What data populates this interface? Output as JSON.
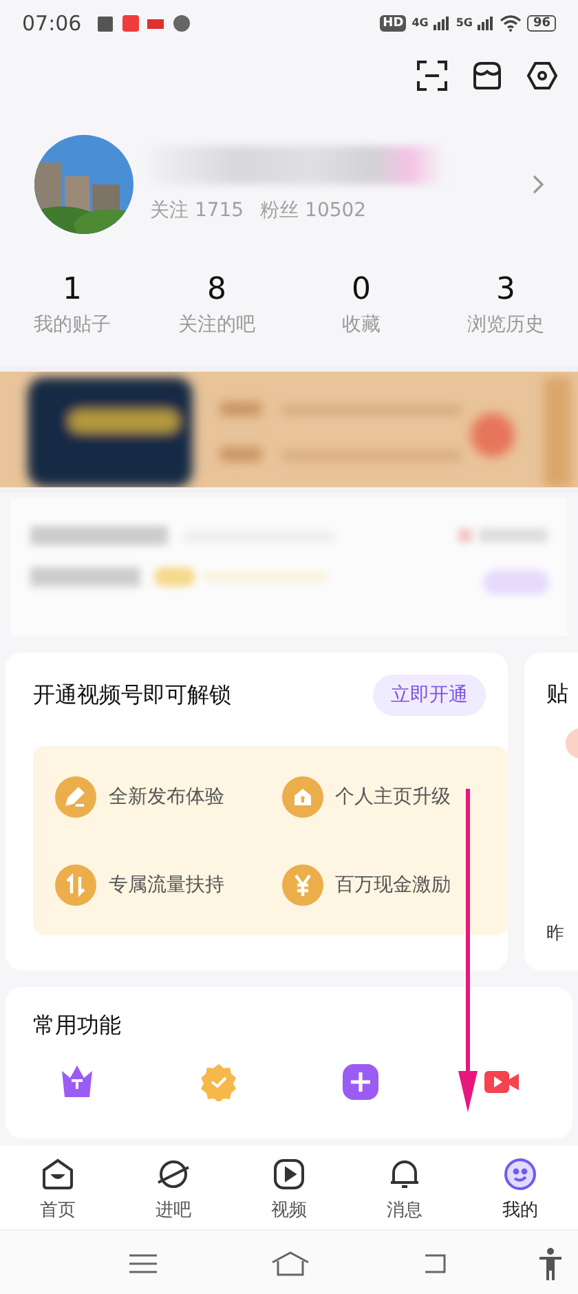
{
  "status_bar": {
    "time": "07:06",
    "hd": "HD",
    "net1": "4G",
    "net2": "5G",
    "battery": "96"
  },
  "profile": {
    "following": "关注 1715",
    "fans": "粉丝 10502"
  },
  "stats": [
    {
      "value": "1",
      "label": "我的贴子"
    },
    {
      "value": "8",
      "label": "关注的吧"
    },
    {
      "value": "0",
      "label": "收藏"
    },
    {
      "value": "3",
      "label": "浏览历史"
    }
  ],
  "video_card": {
    "title": "开通视频号即可解锁",
    "button": "立即开通",
    "benefits": [
      {
        "kind": "pen",
        "label": "全新发布体验"
      },
      {
        "kind": "home",
        "label": "个人主页升级"
      },
      {
        "kind": "traffic",
        "label": "专属流量扶持"
      },
      {
        "kind": "yen",
        "label": "百万现金激励"
      }
    ]
  },
  "side_card": {
    "title": "贴",
    "footer": "昨"
  },
  "functions": {
    "title": "常用功能",
    "items": [
      {
        "kind": "crown",
        "color": "#9b5cf5"
      },
      {
        "kind": "badge",
        "color": "#f7b84b"
      },
      {
        "kind": "plus",
        "color": "#9b5cf5"
      },
      {
        "kind": "live",
        "color": "#f5434f"
      }
    ]
  },
  "tabs": [
    {
      "kind": "home",
      "label": "首页",
      "selected": false
    },
    {
      "kind": "planet",
      "label": "进吧",
      "selected": false
    },
    {
      "kind": "video",
      "label": "视频",
      "selected": false
    },
    {
      "kind": "bell",
      "label": "消息",
      "selected": false
    },
    {
      "kind": "face",
      "label": "我的",
      "selected": true
    }
  ]
}
